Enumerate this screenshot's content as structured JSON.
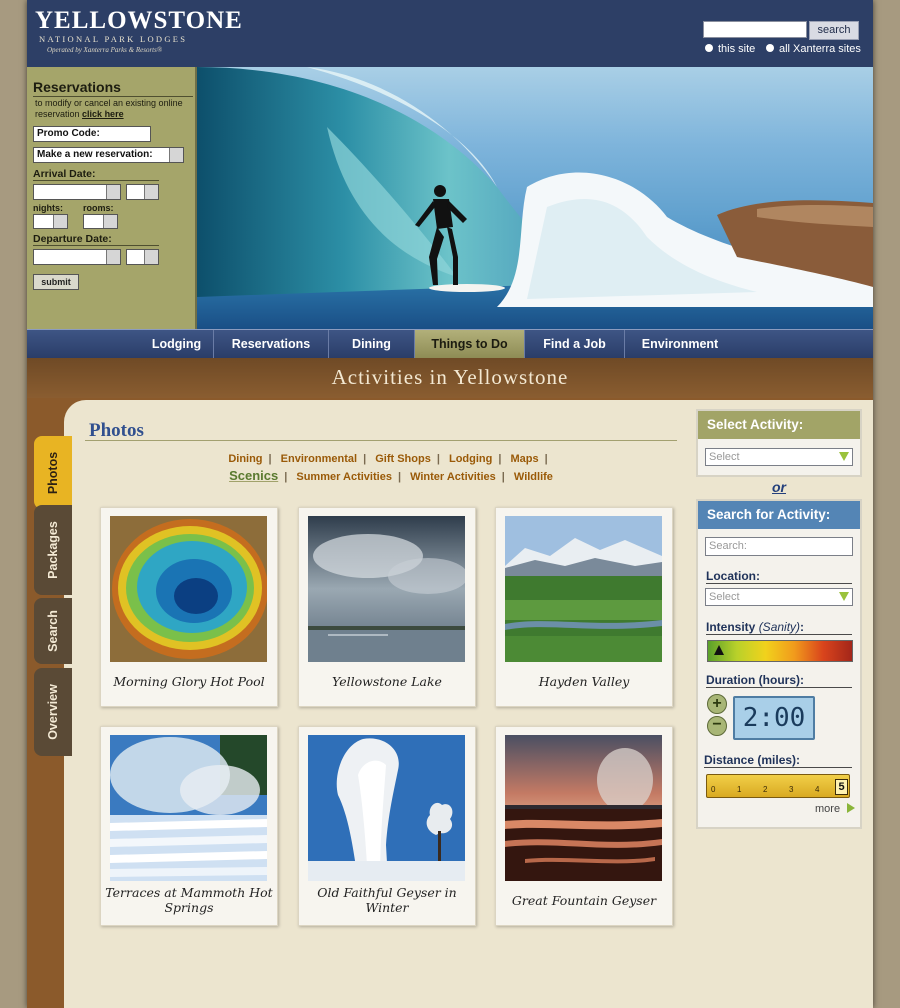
{
  "header": {
    "logo_main": "YELLOWSTONE",
    "logo_sub": "NATIONAL PARK LODGES",
    "logo_operator": "Operated by Xanterra Parks & Resorts®",
    "search_button": "search",
    "radio_this_site": "this site",
    "radio_all_sites": "all Xanterra sites"
  },
  "reservations": {
    "title": "Reservations",
    "note": "to modify or cancel an existing online reservation",
    "note_link": "click here",
    "promo_code": "Promo Code:",
    "make_new": "Make a new reservation:",
    "arrival_label": "Arrival Date:",
    "nights_label": "nights:",
    "rooms_label": "rooms:",
    "departure_label": "Departure Date:",
    "submit": "submit"
  },
  "nav": {
    "items": [
      "Lodging",
      "Reservations",
      "Dining",
      "Things to Do",
      "Find a Job",
      "Environment"
    ],
    "active": "Things to Do"
  },
  "banner": {
    "title": "Activities in Yellowstone"
  },
  "tabs": [
    "Photos",
    "Packages",
    "Search",
    "Overview"
  ],
  "photos": {
    "title": "Photos",
    "categories_row1": [
      "Dining",
      "Environmental",
      "Gift Shops",
      "Lodging",
      "Maps"
    ],
    "categories_row2": [
      "Scenics",
      "Summer Activities",
      "Winter Activities",
      "Wildlife"
    ],
    "current_category": "Scenics",
    "cards": [
      {
        "caption": "Morning Glory Hot Pool"
      },
      {
        "caption": "Yellowstone Lake"
      },
      {
        "caption": "Hayden Valley"
      },
      {
        "caption": "Terraces at Mammoth Hot Springs"
      },
      {
        "caption": "Old Faithful Geyser in Winter"
      },
      {
        "caption": "Great Fountain Geyser"
      }
    ]
  },
  "sidebar": {
    "select_activity_title": "Select Activity:",
    "select_placeholder": "Select",
    "or_text": "or",
    "search_activity_title": "Search for Activity:",
    "search_placeholder": "Search:",
    "location_label": "Location:",
    "location_placeholder": "Select",
    "intensity_label": "Intensity",
    "intensity_sub": "(Sanity)",
    "intensity_colon": ":",
    "duration_label": "Duration (hours):",
    "duration_value": "2:00",
    "distance_label": "Distance (miles):",
    "ruler_ticks": [
      "0",
      "1",
      "2",
      "3",
      "4"
    ],
    "distance_value": "5",
    "more_link": "more"
  },
  "colors": {
    "header_blue": "#2d3f66",
    "res_olive": "#a5a56a",
    "nav_active": "#a8a66e",
    "tab_active": "#e8b423",
    "panel_green": "#a2a467",
    "panel_blue": "#5485b5",
    "link_brown": "#9a5a08"
  }
}
